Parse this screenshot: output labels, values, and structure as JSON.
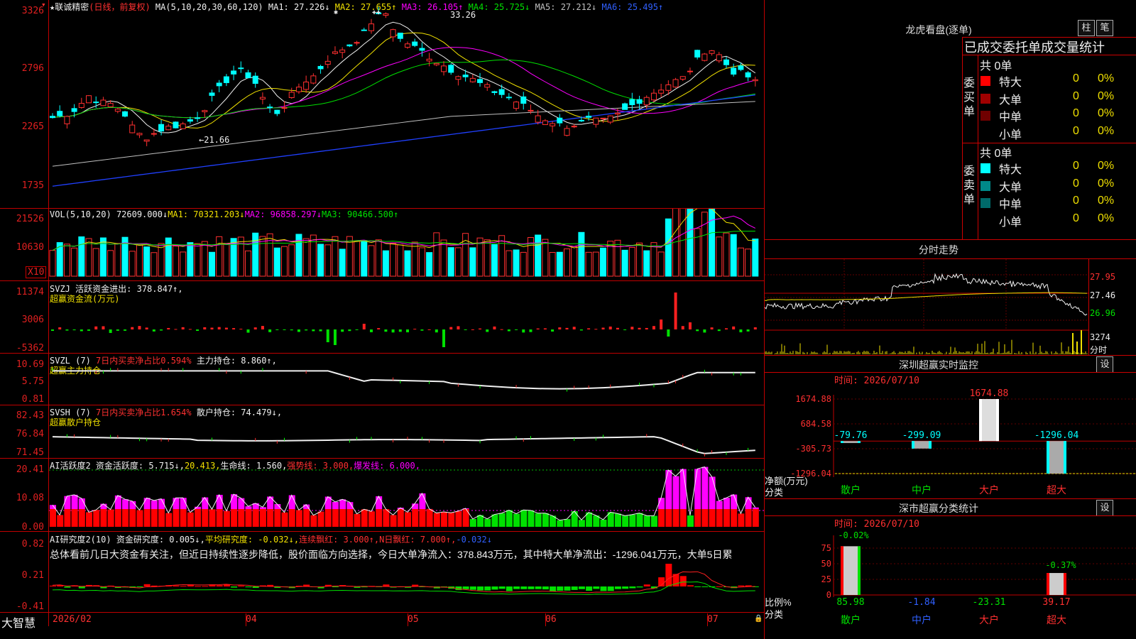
{
  "main": {
    "stock_title": "★联诚精密",
    "mode": "(日线，前复权)",
    "ma_label": "MA(5,10,20,30,60,120)",
    "ma_values": [
      {
        "name": "MA1:",
        "value": "27.226↓",
        "color": "#f0f0f0"
      },
      {
        "name": "MA2:",
        "value": "27.655↑",
        "color": "#f0e000"
      },
      {
        "name": "MA3:",
        "value": "26.105↑",
        "color": "#ff00ff"
      },
      {
        "name": "MA4:",
        "value": "25.725↓",
        "color": "#00e000"
      },
      {
        "name": "MA5:",
        "value": "27.212↓",
        "color": "#c0c0c0"
      },
      {
        "name": "MA6:",
        "value": "25.495↑",
        "color": "#3060ff"
      }
    ],
    "yticks": [
      "3326",
      "2796",
      "2265",
      "1735"
    ],
    "high_label": "33.26",
    "low_label": "←21.66",
    "flags": [
      "✱",
      "✚✚"
    ]
  },
  "vol": {
    "title": "VOL(5,10,20)",
    "value": "72609.000↓",
    "ma1": "MA1: 70321.203↓",
    "ma2": "MA2: 96858.297↓",
    "ma3": "MA3: 90466.500↑",
    "yticks": [
      "21526",
      "10630"
    ],
    "unit": "X10"
  },
  "svzj": {
    "title": "SVZJ",
    "text": "活跃资金进出: 378.847↑,",
    "sub": "超赢资金流(万元)",
    "yticks": [
      "11374",
      "3006",
      "-5362"
    ]
  },
  "svzl": {
    "title": "SVZL (7)",
    "ratio": "7日内买卖净占比0.594%",
    "hold": "主力持仓: 8.860↑,",
    "sub": "超赢主力持仓",
    "yticks": [
      "10.69",
      "5.75",
      "0.81"
    ]
  },
  "svsh": {
    "title": "SVSH (7)",
    "ratio": "7日内买卖净占比1.654%",
    "hold": "散户持仓: 74.479↓,",
    "sub": "超赢散户持仓",
    "yticks": [
      "82.43",
      "76.84",
      "71.45"
    ]
  },
  "ai1": {
    "title": "AI活跃度2",
    "t1": "资金活跃度: 5.715↓,",
    "t2": "20.413,",
    "t3": "生命线: 1.560,",
    "t4": "强势线: 3.000,",
    "t5": "爆发线: 6.000,",
    "yticks": [
      "20.41",
      "10.08",
      "0.00"
    ]
  },
  "ai2": {
    "title": "AI研究度2(10)",
    "t1": "资金研究度: 0.005↓,",
    "t2": "平均研究度: -0.032↓,",
    "t3": "连续飘红: 3.000↑,",
    "t4": "N日飘红: 7.000↑,",
    "t5": "-0.032↓",
    "summary": "总体看前几日大资金有关注，但近日持续性逐步降低，股价面临方向选择，今日大单净流入：378.843万元，其中特大单净流出：-1296.041万元，大单5日累",
    "yticks": [
      "0.82",
      "0.21",
      "-0.41"
    ]
  },
  "xaxis": {
    "brand": "大智慧",
    "labels": [
      "2026/02",
      "04",
      "05",
      "06",
      "07"
    ]
  },
  "lhb": {
    "title": "龙虎看盘(逐单)",
    "btn1": "柱",
    "btn2": "笔",
    "tabs": "已成交委托单成交量统计",
    "buy_label": "委买单",
    "sell_label": "委卖单",
    "buy_total": "共 0单",
    "sell_total": "共 0单",
    "buy_rows": [
      {
        "name": "特大",
        "count": "0",
        "pct": "0%",
        "color": "#ff0000"
      },
      {
        "name": "大单",
        "count": "0",
        "pct": "0%",
        "color": "#a00000"
      },
      {
        "name": "中单",
        "count": "0",
        "pct": "0%",
        "color": "#700000"
      },
      {
        "name": "小单",
        "count": "0",
        "pct": "0%",
        "color": "#000000"
      }
    ],
    "sell_rows": [
      {
        "name": "特大",
        "count": "0",
        "pct": "0%",
        "color": "#00ffff"
      },
      {
        "name": "大单",
        "count": "0",
        "pct": "0%",
        "color": "#008888"
      },
      {
        "name": "中单",
        "count": "0",
        "pct": "0%",
        "color": "#006a6a"
      },
      {
        "name": "小单",
        "count": "0",
        "pct": "0%",
        "color": "#000000"
      }
    ]
  },
  "intraday": {
    "title": "分时走势",
    "yticks": [
      "27.95",
      "27.46",
      "26.96"
    ],
    "vol_label": "3274",
    "vol_unit": "分时"
  },
  "sz_monitor": {
    "title": "深圳超赢实时监控",
    "btn": "设",
    "time": "时间: 2026/07/10",
    "yticks": [
      "1674.88",
      "684.58",
      "-305.73",
      "-1296.04"
    ],
    "bar_labels": [
      "-79.76",
      "-299.09",
      "1674.88",
      "-1296.04"
    ],
    "categories": [
      "散户",
      "中户",
      "大户",
      "超大"
    ],
    "ylabel1": "净额(万元)",
    "ylabel2": "分类"
  },
  "sz_class": {
    "title": "深市超赢分类统计",
    "btn": "设",
    "time": "时间: 2026/07/10",
    "yticks": [
      "75",
      "50",
      "25",
      "0"
    ],
    "top_labels": [
      "-0.02%",
      "-0.37%"
    ],
    "values": [
      "85.98",
      "-1.84",
      "-23.31",
      "39.17"
    ],
    "categories": [
      "散户",
      "中户",
      "大户",
      "超大"
    ],
    "ylabel1": "比例%",
    "ylabel2": "分类"
  },
  "chart_data": {
    "type": "bar",
    "title": "深圳超赢实时监控",
    "categories": [
      "散户",
      "中户",
      "大户",
      "超大"
    ],
    "values": [
      -79.76,
      -299.09,
      1674.88,
      -1296.04
    ],
    "ylim": [
      -1296.04,
      1674.88
    ],
    "ylabel": "净额(万元)"
  }
}
